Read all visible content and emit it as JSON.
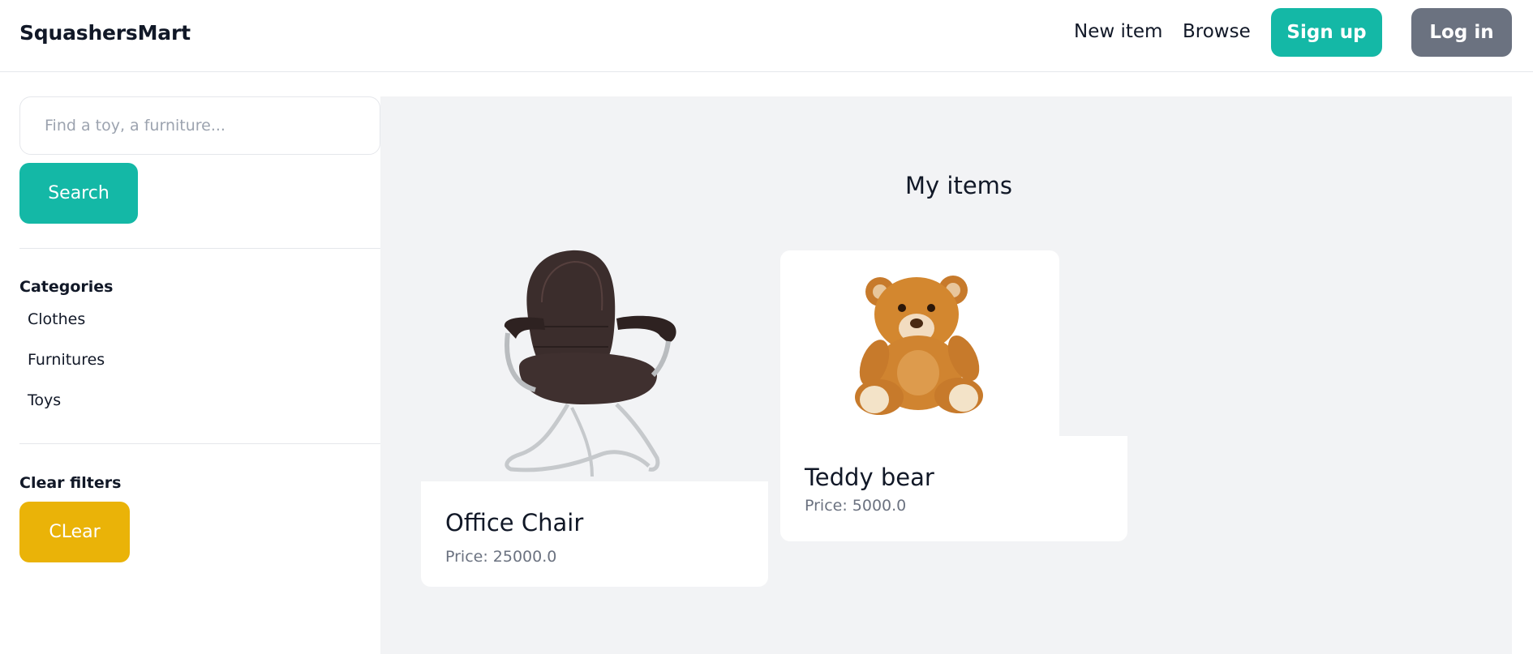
{
  "navbar": {
    "brand": "SquashersMart",
    "links": [
      "New item",
      "Browse"
    ],
    "signup_label": "Sign up",
    "login_label": "Log in"
  },
  "sidebar": {
    "search": {
      "placeholder": "Find a toy, a furniture...",
      "value": ""
    },
    "search_button": "Search",
    "categories_title": "Categories",
    "categories": [
      "Clothes",
      "Furnitures",
      "Toys"
    ],
    "clear_title": "Clear filters",
    "clear_button": "CLear"
  },
  "main": {
    "heading": "My items",
    "items": [
      {
        "title": "Office Chair",
        "price": "Price: 25000.0",
        "image_icon": "office-chair-image"
      },
      {
        "title": "Teddy bear",
        "price": "Price: 5000.0",
        "image_icon": "teddy-bear-image"
      }
    ]
  },
  "colors": {
    "primary": "#14b8a6",
    "secondary": "#6b7280",
    "warning": "#eab308",
    "background": "#f2f3f5"
  }
}
